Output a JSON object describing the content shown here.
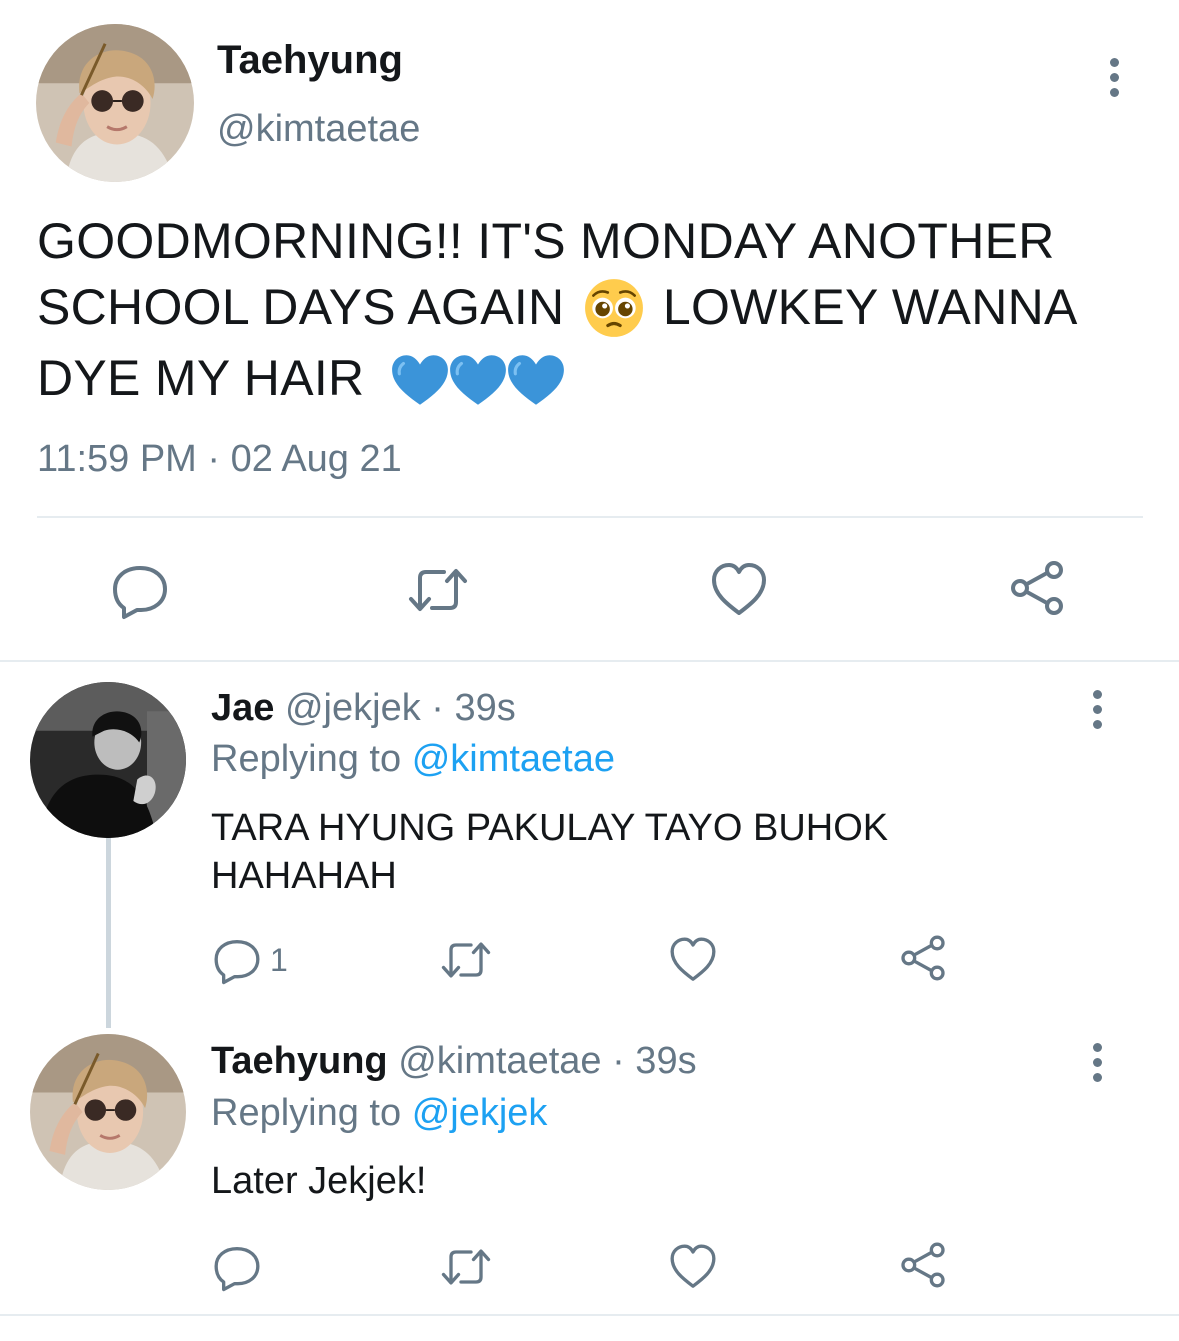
{
  "tweet": {
    "name": "Taehyung",
    "handle": "@kimtaetae",
    "text_line1": "GOODMORNING!! IT'S MONDAY ANOTHER",
    "text_line2a": "SCHOOL DAYS AGAIN",
    "text_line2b": "LOWKEY WANNA",
    "text_line3": "DYE MY HAIR",
    "timestamp": "11:59 PM · 02 Aug 21",
    "avatar_icon": "avatar-photo-icon",
    "emoji_pleading": "pleading-face-icon",
    "emoji_heart": "blue-heart-icon"
  },
  "actions": {
    "reply_icon": "reply-icon",
    "retweet_icon": "retweet-icon",
    "like_icon": "heart-icon",
    "share_icon": "share-icon"
  },
  "replies": [
    {
      "name": "Jae",
      "handle": "@jekjek",
      "time": "· 39s",
      "replying_prefix": "Replying to",
      "replying_to": "@kimtaetae",
      "text_line1": "TARA HYUNG PAKULAY TAYO BUHOK",
      "text_line2": "HAHAHAH",
      "reply_count": "1"
    },
    {
      "name": "Taehyung",
      "handle": "@kimtaetae",
      "time": "· 39s",
      "replying_prefix": "Replying to",
      "replying_to": "@jekjek",
      "text_line1": "Later Jekjek!",
      "reply_count": ""
    }
  ],
  "colors": {
    "text": "#14171a",
    "secondary": "#657786",
    "accent": "#1da1f2",
    "divider": "#e6ecf0",
    "heart_blue": "#3b94d9"
  }
}
